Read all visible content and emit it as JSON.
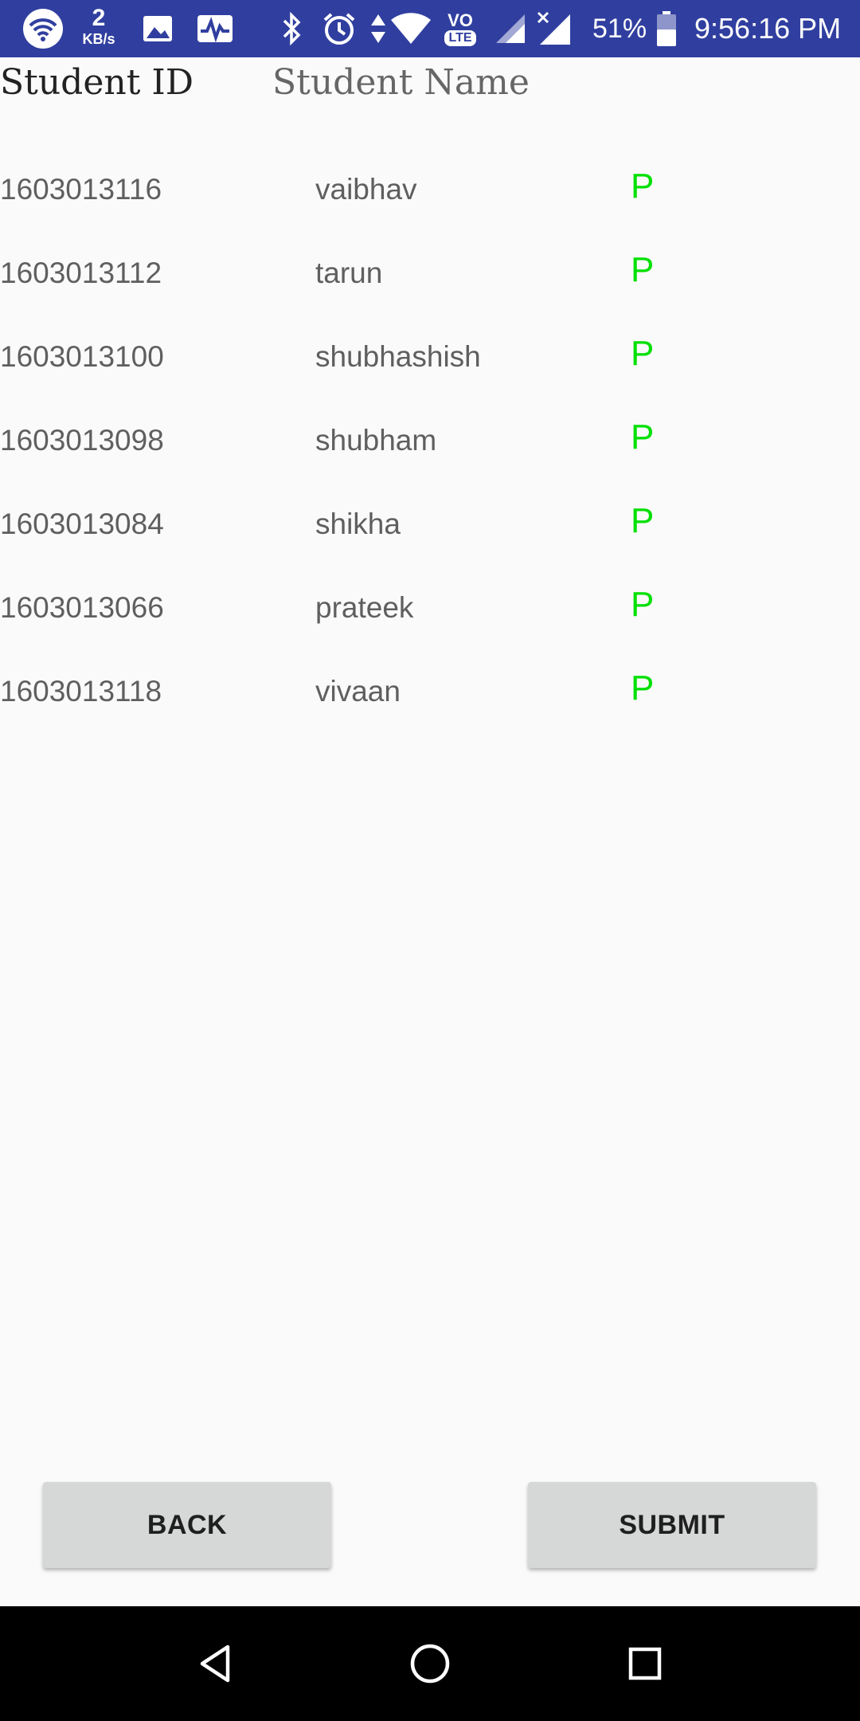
{
  "status_bar": {
    "net_speed_value": "2",
    "net_speed_unit": "KB/s",
    "lte_label": "LTE",
    "vo_label": "VO",
    "battery": "51%",
    "time": "9:56:16 PM",
    "icons": [
      "wifi-icon",
      "gallery-icon",
      "activity-icon",
      "bluetooth-icon",
      "alarm-icon",
      "data-arrows-icon",
      "wifi-signal-icon",
      "volte-icon",
      "cell-signal-icon",
      "cell-signal-no-data-icon",
      "battery-icon"
    ]
  },
  "header": {
    "student_id_label": "Student ID",
    "student_name_label": "Student Name"
  },
  "students": [
    {
      "id": "1603013116",
      "name": "vaibhav",
      "status": "P"
    },
    {
      "id": "1603013112",
      "name": "tarun",
      "status": "P"
    },
    {
      "id": "1603013100",
      "name": "shubhashish",
      "status": "P"
    },
    {
      "id": "1603013098",
      "name": "shubham",
      "status": "P"
    },
    {
      "id": "1603013084",
      "name": "shikha",
      "status": "P"
    },
    {
      "id": "1603013066",
      "name": "prateek",
      "status": "P"
    },
    {
      "id": "1603013118",
      "name": "vivaan",
      "status": "P"
    }
  ],
  "buttons": {
    "back_label": "BACK",
    "submit_label": "SUBMIT"
  },
  "colors": {
    "status_bar": "#303f9f",
    "present": "#00e000",
    "button_bg": "#d6d7d7",
    "background": "#fafafa"
  },
  "nav_bar": {
    "icons": [
      "back-icon",
      "home-icon",
      "recents-icon"
    ]
  }
}
